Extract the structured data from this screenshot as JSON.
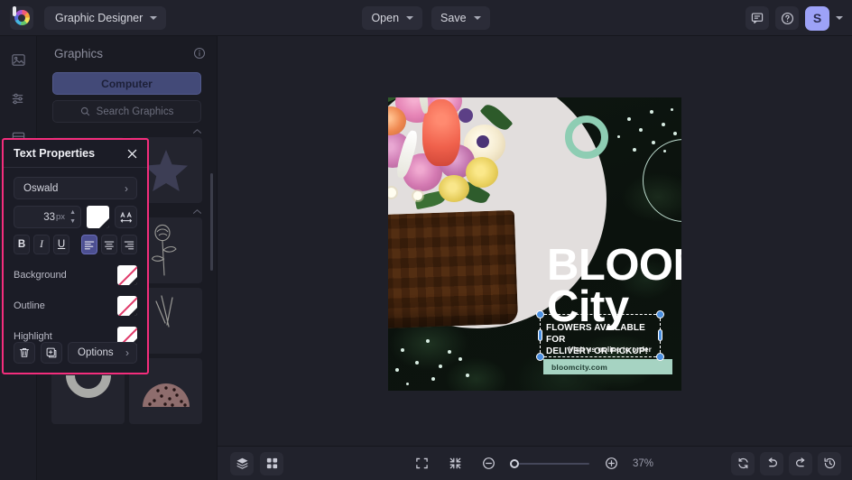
{
  "topbar": {
    "logo_icon": "color-wheel-logo-icon",
    "doc_title": "Graphic Designer",
    "open_label": "Open",
    "save_label": "Save",
    "comment_icon": "comment-icon",
    "help_icon": "help-circle-icon",
    "avatar_initial": "S"
  },
  "rail": {
    "items": [
      {
        "icon": "image-icon",
        "name": "sidebar-item-images"
      },
      {
        "icon": "sliders-icon",
        "name": "sidebar-item-adjustments"
      },
      {
        "icon": "layout-icon",
        "name": "sidebar-item-layout"
      }
    ]
  },
  "graphics_panel": {
    "title": "Graphics",
    "info_icon": "info-circle-icon",
    "computer_label": "Computer",
    "search_placeholder": "Search Graphics",
    "search_icon": "search-icon",
    "collapse_icon": "chevron-up-icon",
    "thumbnails": [
      {
        "name": "thumb-triangle"
      },
      {
        "name": "thumb-star"
      },
      {
        "name": "thumb-pinterest-logo"
      },
      {
        "name": "thumb-rose-sketch"
      },
      {
        "name": "thumb-line-stroke"
      },
      {
        "name": "thumb-scratch-lines"
      },
      {
        "name": "thumb-arc-shape"
      },
      {
        "name": "thumb-dotted-dome"
      }
    ]
  },
  "text_properties": {
    "title": "Text Properties",
    "close_icon": "close-icon",
    "font_family": "Oswald",
    "font_size": "33",
    "font_size_unit": "px",
    "color_swatch": "white",
    "letter_spacing_icon": "letter-spacing-icon",
    "format": {
      "bold": "B",
      "italic": "I",
      "underline": "U",
      "align_left": "align-left-icon",
      "align_center": "align-center-icon",
      "align_right": "align-right-icon",
      "active_align": "align_left"
    },
    "properties": [
      {
        "label": "Background",
        "value": "none"
      },
      {
        "label": "Outline",
        "value": "none"
      },
      {
        "label": "Highlight",
        "value": "none"
      }
    ],
    "footer": {
      "delete_icon": "trash-icon",
      "duplicate_icon": "duplicate-icon",
      "options_label": "Options",
      "options_chevron": "chevron-right-icon"
    },
    "accent_color": "#f42d7c"
  },
  "canvas": {
    "design": {
      "headline_line1": "BLOOM",
      "headline_line2": "City",
      "sub_line1": "FLOWERS AVAILABLE FOR",
      "sub_line2": "DELIVERY OR PICKUP!",
      "tagline": "Visit us online to order",
      "url_bar": "bloomcity.com",
      "accent_mint": "#a6d3c2"
    },
    "selection": {
      "active": true,
      "handle_color": "#4a8fe0"
    }
  },
  "bottombar": {
    "layers_icon": "layers-icon",
    "grid_icon": "grid-icon",
    "fit_icon": "fit-screen-icon",
    "shrink_icon": "shrink-icon",
    "zoom_out_icon": "zoom-out-icon",
    "zoom_in_icon": "zoom-in-icon",
    "zoom_level": "37%",
    "refresh_icon": "refresh-icon",
    "undo_icon": "undo-icon",
    "redo_icon": "redo-icon",
    "history_icon": "history-icon"
  }
}
